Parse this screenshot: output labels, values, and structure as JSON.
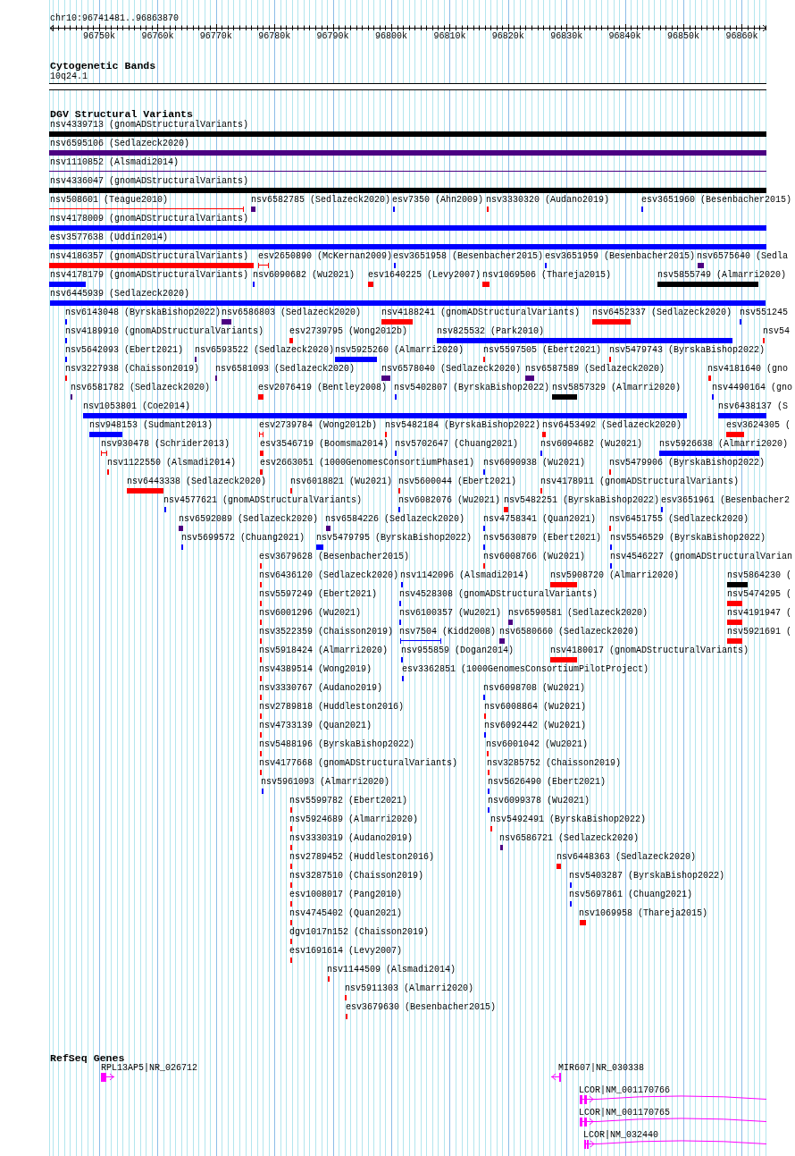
{
  "ruler": {
    "position": "chr10:96741481..96863870",
    "labels": [
      "96750k",
      "96760k",
      "96770k",
      "96780k",
      "96790k",
      "96800k",
      "96810k",
      "96820k",
      "96830k",
      "96840k",
      "96850k",
      "96860k"
    ]
  },
  "cytogenetic_bands": {
    "title": "Cytogenetic Bands",
    "band": "10q24.1"
  },
  "dgv_structural_variants": {
    "title": "DGV Structural Variants",
    "lanes": [
      {
        "items": [
          {
            "label": "nsv4339713 (gnomADStructuralVariants)",
            "color": "#000000",
            "kind": "block"
          }
        ]
      },
      {
        "items": [
          {
            "label": "nsv6595106 (Sedlazeck2020)",
            "color": "#4b0082",
            "kind": "block"
          }
        ]
      },
      {
        "items": [
          {
            "label": "nsv1110852 (Alsmadi2014)",
            "color": "#4b0082",
            "kind": "interval"
          }
        ]
      },
      {
        "items": [
          {
            "label": "nsv4336047 (gnomADStructuralVariants)",
            "color": "#000000",
            "kind": "block"
          }
        ]
      },
      {
        "items": [
          {
            "label": "nsv508601 (Teague2010)",
            "color": "#ff0000",
            "kind": "interval"
          },
          {
            "label": "nsv6582785 (Sedlazeck2020)",
            "color": "#4b0082",
            "kind": "block"
          },
          {
            "label": "esv7350 (Ahn2009)",
            "color": "#0000ff",
            "kind": "block"
          },
          {
            "label": "nsv3330320 (Audano2019)",
            "color": "#ff0000",
            "kind": "block"
          },
          {
            "label": "esv3651960 (Besenbacher2015)",
            "color": "#0000ff",
            "kind": "block"
          }
        ]
      },
      {
        "items": [
          {
            "label": "nsv4178009 (gnomADStructuralVariants)",
            "color": "#0000ff",
            "kind": "block"
          }
        ]
      },
      {
        "items": [
          {
            "label": "esv3577638 (Uddin2014)",
            "color": "#0000ff",
            "kind": "block"
          }
        ]
      },
      {
        "items": [
          {
            "label": "nsv4186357 (gnomADStructuralVariants)",
            "color": "#ff0000",
            "kind": "block"
          },
          {
            "label": "esv2650890 (McKernan2009)",
            "color": "#ff0000",
            "kind": "interval"
          },
          {
            "label": "esv3651958 (Besenbacher2015)",
            "color": "#0000ff",
            "kind": "block"
          },
          {
            "label": "esv3651959 (Besenbacher2015)",
            "color": "#0000ff",
            "kind": "block"
          },
          {
            "label": "nsv6575640 (Sedla",
            "color": "#4b0082",
            "kind": "block"
          }
        ]
      },
      {
        "items": [
          {
            "label": "nsv4178179 (gnomADStructuralVariants)",
            "color": "#0000ff",
            "kind": "block"
          },
          {
            "label": "nsv6090682 (Wu2021)",
            "color": "#0000ff",
            "kind": "block"
          },
          {
            "label": "esv1640225 (Levy2007)",
            "color": "#ff0000",
            "kind": "block"
          },
          {
            "label": "nsv1069506 (Thareja2015)",
            "color": "#ff0000",
            "kind": "block"
          },
          {
            "label": "nsv5855749 (Almarri2020)",
            "color": "#000000",
            "kind": "block"
          }
        ]
      },
      {
        "items": [
          {
            "label": "nsv6445939 (Sedlazeck2020)",
            "color": "#0000ff",
            "kind": "block"
          }
        ]
      },
      {
        "items": [
          {
            "label": "nsv6143048 (ByrskaBishop2022)",
            "color": "#0000ff",
            "kind": "block"
          },
          {
            "label": "nsv6586803 (Sedlazeck2020)",
            "color": "#4b0082",
            "kind": "block"
          },
          {
            "label": "nsv4188241 (gnomADStructuralVariants)",
            "color": "#ff0000",
            "kind": "block"
          },
          {
            "label": "nsv6452337 (Sedlazeck2020)",
            "color": "#ff0000",
            "kind": "block"
          },
          {
            "label": "nsv551245",
            "color": "#0000ff",
            "kind": "block"
          }
        ]
      },
      {
        "items": [
          {
            "label": "nsv4189910 (gnomADStructuralVariants)",
            "color": "#0000ff",
            "kind": "block"
          },
          {
            "label": "esv2739795 (Wong2012b)",
            "color": "#ff0000",
            "kind": "block"
          },
          {
            "label": "nsv825532 (Park2010)",
            "color": "#0000ff",
            "kind": "block"
          },
          {
            "label": "nsv54",
            "color": "#ff0000",
            "kind": "block"
          }
        ]
      },
      {
        "items": [
          {
            "label": "nsv5642093 (Ebert2021)",
            "color": "#0000ff",
            "kind": "block"
          },
          {
            "label": "nsv6593522 (Sedlazeck2020)",
            "color": "#4b0082",
            "kind": "block"
          },
          {
            "label": "nsv5925260 (Almarri2020)",
            "color": "#0000ff",
            "kind": "block"
          },
          {
            "label": "nsv5597505 (Ebert2021)",
            "color": "#ff0000",
            "kind": "block"
          },
          {
            "label": "nsv5479743 (ByrskaBishop2022)",
            "color": "#ff0000",
            "kind": "block"
          }
        ]
      },
      {
        "items": [
          {
            "label": "nsv3227938 (Chaisson2019)",
            "color": "#ff0000",
            "kind": "block"
          },
          {
            "label": "nsv6581093 (Sedlazeck2020)",
            "color": "#4b0082",
            "kind": "block"
          },
          {
            "label": "nsv6578040 (Sedlazeck2020)",
            "color": "#4b0082",
            "kind": "block"
          },
          {
            "label": "nsv6587589 (Sedlazeck2020)",
            "color": "#4b0082",
            "kind": "block"
          },
          {
            "label": "nsv4181640 (gno",
            "color": "#ff0000",
            "kind": "block"
          }
        ]
      },
      {
        "items": [
          {
            "label": "nsv6581782 (Sedlazeck2020)",
            "color": "#4b0082",
            "kind": "block"
          },
          {
            "label": "esv2076419 (Bentley2008)",
            "color": "#ff0000",
            "kind": "block"
          },
          {
            "label": "nsv5402807 (ByrskaBishop2022)",
            "color": "#0000ff",
            "kind": "block"
          },
          {
            "label": "nsv5857329 (Almarri2020)",
            "color": "#000000",
            "kind": "block"
          },
          {
            "label": "nsv4490164 (gno",
            "color": "#0000ff",
            "kind": "block"
          }
        ]
      },
      {
        "items": [
          {
            "label": "nsv1053801 (Coe2014)",
            "color": "#0000ff",
            "kind": "block"
          },
          {
            "label": "nsv6438137 (S",
            "color": "#0000ff",
            "kind": "block"
          }
        ]
      },
      {
        "items": [
          {
            "label": "nsv948153 (Sudmant2013)",
            "color": "#0000ff",
            "kind": "block"
          },
          {
            "label": "esv2739784 (Wong2012b)",
            "color": "#ff0000",
            "kind": "interval"
          },
          {
            "label": "nsv5482184 (ByrskaBishop2022)",
            "color": "#ff0000",
            "kind": "block"
          },
          {
            "label": "nsv6453492 (Sedlazeck2020)",
            "color": "#ff0000",
            "kind": "block"
          },
          {
            "label": "esv3624305 (",
            "color": "#ff0000",
            "kind": "block"
          }
        ]
      },
      {
        "items": [
          {
            "label": "nsv930478 (Schrider2013)",
            "color": "#ff0000",
            "kind": "interval"
          },
          {
            "label": "esv3546719 (Boomsma2014)",
            "color": "#ff0000",
            "kind": "block"
          },
          {
            "label": "nsv5702647 (Chuang2021)",
            "color": "#0000ff",
            "kind": "block"
          },
          {
            "label": "nsv6094682 (Wu2021)",
            "color": "#0000ff",
            "kind": "block"
          },
          {
            "label": "nsv5926638 (Almarri2020)",
            "color": "#0000ff",
            "kind": "block"
          }
        ]
      },
      {
        "items": [
          {
            "label": "nsv1122550 (Alsmadi2014)",
            "color": "#ff0000",
            "kind": "block"
          },
          {
            "label": "esv2663051 (1000GenomesConsortiumPhase1)",
            "color": "#ff0000",
            "kind": "block"
          },
          {
            "label": "nsv6090938 (Wu2021)",
            "color": "#0000ff",
            "kind": "block"
          },
          {
            "label": "nsv5479906 (ByrskaBishop2022)",
            "color": "#ff0000",
            "kind": "block"
          }
        ]
      },
      {
        "items": [
          {
            "label": "nsv6443338 (Sedlazeck2020)",
            "color": "#ff0000",
            "kind": "block"
          },
          {
            "label": "nsv6018821 (Wu2021)",
            "color": "#ff0000",
            "kind": "block"
          },
          {
            "label": "nsv5600044 (Ebert2021)",
            "color": "#ff0000",
            "kind": "block"
          },
          {
            "label": "nsv4178911 (gnomADStructuralVariants)",
            "color": "#ff0000",
            "kind": "block"
          }
        ]
      },
      {
        "items": [
          {
            "label": "nsv4577621 (gnomADStructuralVariants)",
            "color": "#0000ff",
            "kind": "block"
          },
          {
            "label": "nsv6082076 (Wu2021)",
            "color": "#0000ff",
            "kind": "block"
          },
          {
            "label": "nsv5482251 (ByrskaBishop2022)",
            "color": "#ff0000",
            "kind": "block"
          },
          {
            "label": "esv3651961 (Besenbacher2",
            "color": "#0000ff",
            "kind": "block"
          }
        ]
      },
      {
        "items": [
          {
            "label": "nsv6592089 (Sedlazeck2020)",
            "color": "#4b0082",
            "kind": "block"
          },
          {
            "label": "nsv6584226 (Sedlazeck2020)",
            "color": "#4b0082",
            "kind": "block"
          },
          {
            "label": "nsv4758341 (Quan2021)",
            "color": "#0000ff",
            "kind": "block"
          },
          {
            "label": "nsv6451755 (Sedlazeck2020)",
            "color": "#ff0000",
            "kind": "block"
          }
        ]
      },
      {
        "items": [
          {
            "label": "nsv5699572 (Chuang2021)",
            "color": "#0000ff",
            "kind": "block"
          },
          {
            "label": "nsv5479795 (ByrskaBishop2022)",
            "color": "#0000ff",
            "kind": "block"
          },
          {
            "label": "nsv5630879 (Ebert2021)",
            "color": "#0000ff",
            "kind": "block"
          },
          {
            "label": "nsv5546529 (ByrskaBishop2022)",
            "color": "#0000ff",
            "kind": "block"
          }
        ]
      },
      {
        "items": [
          {
            "label": "esv3679628 (Besenbacher2015)",
            "color": "#ff0000",
            "kind": "block"
          },
          {
            "label": "nsv6008766 (Wu2021)",
            "color": "#ff0000",
            "kind": "block"
          },
          {
            "label": "nsv4546227 (gnomADStructuralVarian",
            "color": "#0000ff",
            "kind": "block"
          }
        ]
      },
      {
        "items": [
          {
            "label": "nsv6436120 (Sedlazeck2020)",
            "color": "#ff0000",
            "kind": "block"
          },
          {
            "label": "nsv1142096 (Alsmadi2014)",
            "color": "#0000ff",
            "kind": "block"
          },
          {
            "label": "nsv5908720 (Almarri2020)",
            "color": "#ff0000",
            "kind": "block"
          },
          {
            "label": "nsv5864230 (",
            "color": "#000000",
            "kind": "block"
          }
        ]
      },
      {
        "items": [
          {
            "label": "nsv5597249 (Ebert2021)",
            "color": "#ff0000",
            "kind": "block"
          },
          {
            "label": "nsv4528308 (gnomADStructuralVariants)",
            "color": "#0000ff",
            "kind": "block"
          },
          {
            "label": "nsv5474295 (",
            "color": "#ff0000",
            "kind": "block"
          }
        ]
      },
      {
        "items": [
          {
            "label": "nsv6001296 (Wu2021)",
            "color": "#ff0000",
            "kind": "block"
          },
          {
            "label": "nsv6100357 (Wu2021)",
            "color": "#0000ff",
            "kind": "block"
          },
          {
            "label": "nsv6590581 (Sedlazeck2020)",
            "color": "#4b0082",
            "kind": "block"
          },
          {
            "label": "nsv4191947 (",
            "color": "#ff0000",
            "kind": "block"
          }
        ]
      },
      {
        "items": [
          {
            "label": "nsv3522359 (Chaisson2019)",
            "color": "#ff0000",
            "kind": "block"
          },
          {
            "label": "nsv7504 (Kidd2008)",
            "color": "#0000ff",
            "kind": "interval"
          },
          {
            "label": "nsv6580660 (Sedlazeck2020)",
            "color": "#4b0082",
            "kind": "block"
          },
          {
            "label": "nsv5921691 (",
            "color": "#ff0000",
            "kind": "block"
          }
        ]
      },
      {
        "items": [
          {
            "label": "nsv5918424 (Almarri2020)",
            "color": "#ff0000",
            "kind": "block"
          },
          {
            "label": "nsv955859 (Dogan2014)",
            "color": "#0000ff",
            "kind": "block"
          },
          {
            "label": "nsv4180017 (gnomADStructuralVariants)",
            "color": "#ff0000",
            "kind": "block"
          }
        ]
      },
      {
        "items": [
          {
            "label": "nsv4389514 (Wong2019)",
            "color": "#ff0000",
            "kind": "block"
          },
          {
            "label": "esv3362851 (1000GenomesConsortiumPilotProject)",
            "color": "#0000ff",
            "kind": "block"
          }
        ]
      },
      {
        "items": [
          {
            "label": "nsv3330767 (Audano2019)",
            "color": "#ff0000",
            "kind": "block"
          },
          {
            "label": "nsv6098708 (Wu2021)",
            "color": "#0000ff",
            "kind": "block"
          }
        ]
      },
      {
        "items": [
          {
            "label": "nsv2789818 (Huddleston2016)",
            "color": "#ff0000",
            "kind": "block"
          },
          {
            "label": "nsv6008864 (Wu2021)",
            "color": "#ff0000",
            "kind": "block"
          }
        ]
      },
      {
        "items": [
          {
            "label": "nsv4733139 (Quan2021)",
            "color": "#ff0000",
            "kind": "block"
          },
          {
            "label": "nsv6092442 (Wu2021)",
            "color": "#0000ff",
            "kind": "block"
          }
        ]
      },
      {
        "items": [
          {
            "label": "nsv5488196 (ByrskaBishop2022)",
            "color": "#ff0000",
            "kind": "block"
          },
          {
            "label": "nsv6001042 (Wu2021)",
            "color": "#ff0000",
            "kind": "block"
          }
        ]
      },
      {
        "items": [
          {
            "label": "nsv4177668 (gnomADStructuralVariants)",
            "color": "#ff0000",
            "kind": "block"
          },
          {
            "label": "nsv3285752 (Chaisson2019)",
            "color": "#ff0000",
            "kind": "block"
          }
        ]
      },
      {
        "items": [
          {
            "label": "nsv5961093 (Almarri2020)",
            "color": "#0000ff",
            "kind": "block"
          },
          {
            "label": "nsv5626490 (Ebert2021)",
            "color": "#0000ff",
            "kind": "block"
          }
        ]
      },
      {
        "items": [
          {
            "label": "nsv5599782 (Ebert2021)",
            "color": "#ff0000",
            "kind": "block"
          },
          {
            "label": "nsv6099378 (Wu2021)",
            "color": "#0000ff",
            "kind": "block"
          }
        ]
      },
      {
        "items": [
          {
            "label": "nsv5924689 (Almarri2020)",
            "color": "#ff0000",
            "kind": "block"
          },
          {
            "label": "nsv5492491 (ByrskaBishop2022)",
            "color": "#ff0000",
            "kind": "block"
          }
        ]
      },
      {
        "items": [
          {
            "label": "nsv3330319 (Audano2019)",
            "color": "#ff0000",
            "kind": "block"
          },
          {
            "label": "nsv6586721 (Sedlazeck2020)",
            "color": "#4b0082",
            "kind": "block"
          }
        ]
      },
      {
        "items": [
          {
            "label": "nsv2789452 (Huddleston2016)",
            "color": "#ff0000",
            "kind": "block"
          },
          {
            "label": "nsv6448363 (Sedlazeck2020)",
            "color": "#ff0000",
            "kind": "block"
          }
        ]
      },
      {
        "items": [
          {
            "label": "nsv3287510 (Chaisson2019)",
            "color": "#ff0000",
            "kind": "block"
          },
          {
            "label": "nsv5403287 (ByrskaBishop2022)",
            "color": "#0000ff",
            "kind": "block"
          }
        ]
      },
      {
        "items": [
          {
            "label": "esv1008017 (Pang2010)",
            "color": "#ff0000",
            "kind": "block"
          },
          {
            "label": "nsv5697861 (Chuang2021)",
            "color": "#0000ff",
            "kind": "block"
          }
        ]
      },
      {
        "items": [
          {
            "label": "nsv4745402 (Quan2021)",
            "color": "#ff0000",
            "kind": "block"
          },
          {
            "label": "nsv1069958 (Thareja2015)",
            "color": "#ff0000",
            "kind": "block"
          }
        ]
      },
      {
        "items": [
          {
            "label": "dgv1017n152 (Chaisson2019)",
            "color": "#ff0000",
            "kind": "block"
          }
        ]
      },
      {
        "items": [
          {
            "label": "esv1691614 (Levy2007)",
            "color": "#ff0000",
            "kind": "block"
          }
        ]
      },
      {
        "items": [
          {
            "label": "nsv1144509 (Alsmadi2014)",
            "color": "#ff0000",
            "kind": "block"
          }
        ]
      },
      {
        "items": [
          {
            "label": "nsv5911303 (Almarri2020)",
            "color": "#ff0000",
            "kind": "block"
          }
        ]
      },
      {
        "items": [
          {
            "label": "esv3679630 (Besenbacher2015)",
            "color": "#ff0000",
            "kind": "block"
          }
        ]
      }
    ]
  },
  "refseq_genes": {
    "title": "RefSeq Genes",
    "lanes": [
      {
        "items": [
          {
            "label": "RPL13AP5|NR_026712",
            "reverse": false
          },
          {
            "label": "MIR607|NR_030338",
            "reverse": true
          }
        ]
      },
      {
        "items": [
          {
            "label": "LCOR|NM_001170766",
            "reverse": false
          }
        ]
      },
      {
        "items": [
          {
            "label": "LCOR|NM_001170765",
            "reverse": false
          }
        ]
      },
      {
        "items": [
          {
            "label": "LCOR|NM_032440",
            "reverse": false
          }
        ]
      }
    ]
  }
}
